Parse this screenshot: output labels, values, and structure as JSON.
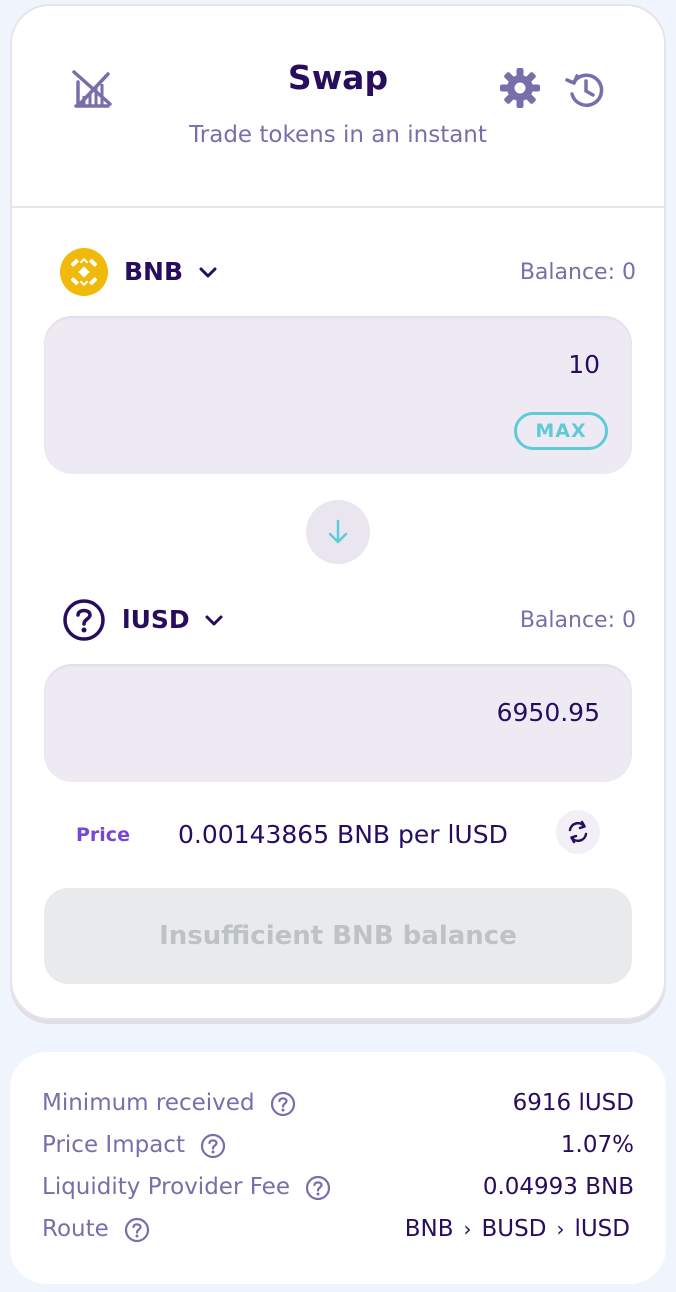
{
  "header": {
    "title": "Swap",
    "subtitle": "Trade tokens in an instant",
    "icons": [
      "chart-disabled-icon",
      "gear-icon",
      "history-icon"
    ]
  },
  "from_token": {
    "symbol": "BNB",
    "balance_label": "Balance: 0",
    "amount": "10",
    "max_label": "MAX",
    "logo_color": "#f0b90b"
  },
  "to_token": {
    "symbol": "lUSD",
    "balance_label": "Balance: 0",
    "amount": "6950.95"
  },
  "price": {
    "label": "Price",
    "value": "0.00143865 BNB per lUSD"
  },
  "action_button": {
    "label": "Insufficient BNB balance"
  },
  "details": {
    "rows": [
      {
        "label": "Minimum received",
        "value": "6916 lUSD"
      },
      {
        "label": "Price Impact",
        "value": "1.07%"
      },
      {
        "label": "Liquidity Provider Fee",
        "value": "0.04993 BNB"
      }
    ],
    "route": {
      "label": "Route",
      "path": [
        "BNB",
        "BUSD",
        "lUSD"
      ],
      "separator": "›"
    }
  },
  "colors": {
    "primary_text": "#280d5f",
    "secondary_text": "#7a6eaa",
    "accent": "#5fcad8",
    "price_label": "#7645d9",
    "input_bg": "#eeeaf4",
    "disabled_bg": "#e9eaeb",
    "page_bg": "#eff4fd"
  }
}
